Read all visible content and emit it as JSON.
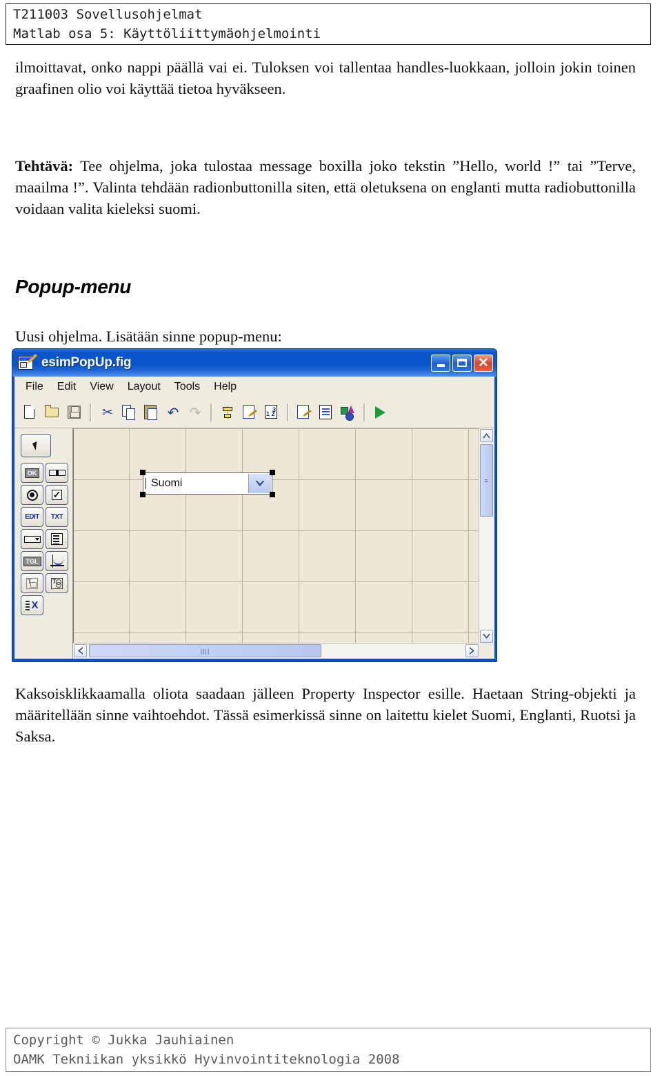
{
  "header": {
    "line1": "T211003 Sovellusohjelmat",
    "line2": "Matlab osa 5: Käyttöliittymäohjelmointi"
  },
  "body": {
    "intro": "ilmoittavat, onko nappi päällä vai ei. Tuloksen voi tallentaa handles-luokkaan, jolloin jokin toinen graafinen olio voi käyttää tietoa hyväkseen.",
    "task_label": "Tehtävä:",
    "task_text": " Tee ohjelma, joka tulostaa message boxilla joko tekstin ”Hello, world !” tai ”Terve, maailma !”. Valinta tehdään radionbuttonilla siten, että oletuksena on englanti mutta radiobuttonilla voidaan valita kieleksi suomi.",
    "section_heading": "Popup-menu",
    "lead_text": "Uusi ohjelma. Lisätään sinne popup-menu:",
    "after_text": "Kaksoisklikkaamalla oliota saadaan jälleen Property Inspector esille. Haetaan String-objekti ja määritellään sinne vaihtoehdot. Tässä esimerkissä sinne on laitettu kielet Suomi, Englanti, Ruotsi ja Saksa."
  },
  "guide_window": {
    "title": "esimPopUp.fig",
    "title_icon": "guide-figure-icon",
    "window_buttons": {
      "minimize": "minimize-icon",
      "maximize": "maximize-icon",
      "close": "close-icon"
    },
    "menu": [
      "File",
      "Edit",
      "View",
      "Layout",
      "Tools",
      "Help"
    ],
    "toolbar": [
      {
        "name": "new-file-icon"
      },
      {
        "name": "open-file-icon"
      },
      {
        "name": "save-file-icon"
      },
      {
        "name": "separator"
      },
      {
        "name": "cut-icon"
      },
      {
        "name": "copy-icon"
      },
      {
        "name": "paste-icon"
      },
      {
        "name": "undo-icon"
      },
      {
        "name": "redo-icon"
      },
      {
        "name": "separator"
      },
      {
        "name": "align-objects-icon"
      },
      {
        "name": "menu-editor-icon"
      },
      {
        "name": "tab-order-editor-icon"
      },
      {
        "name": "separator"
      },
      {
        "name": "m-file-editor-icon"
      },
      {
        "name": "property-inspector-icon"
      },
      {
        "name": "object-browser-icon"
      },
      {
        "name": "separator"
      },
      {
        "name": "run-figure-icon"
      }
    ],
    "palette": [
      {
        "name": "select-tool",
        "label": ""
      },
      {
        "name": "push-button-tool",
        "label": "OK"
      },
      {
        "name": "slider-tool",
        "label": ""
      },
      {
        "name": "radio-button-tool",
        "label": ""
      },
      {
        "name": "check-box-tool",
        "label": ""
      },
      {
        "name": "edit-text-tool",
        "label": "EDIT"
      },
      {
        "name": "static-text-tool",
        "label": "TXT"
      },
      {
        "name": "popup-menu-tool",
        "label": ""
      },
      {
        "name": "listbox-tool",
        "label": ""
      },
      {
        "name": "toggle-button-tool",
        "label": "TGL"
      },
      {
        "name": "axes-tool",
        "label": ""
      },
      {
        "name": "panel-tool",
        "label": "T"
      },
      {
        "name": "button-group-tool",
        "label": "T"
      },
      {
        "name": "activex-tool",
        "label": "X"
      }
    ],
    "canvas": {
      "popup_control": {
        "value": "Suomi",
        "arrow": "chevron-down-icon"
      }
    },
    "scrollbars": {
      "vertical_thumb_marks": "≡",
      "horizontal_thumb_marks": "||||"
    }
  },
  "footer": {
    "line1": "Copyright © Jukka Jauhiainen",
    "line2": "OAMK Tekniikan yksikkö Hyvinvointiteknologia 2008"
  },
  "colors": {
    "titlebar_blue": "#0a55cc",
    "canvas_bg": "#ece7d6",
    "panel_bg": "#efebdf",
    "grid_line": "#b6b09c",
    "close_red": "#d9442a"
  }
}
